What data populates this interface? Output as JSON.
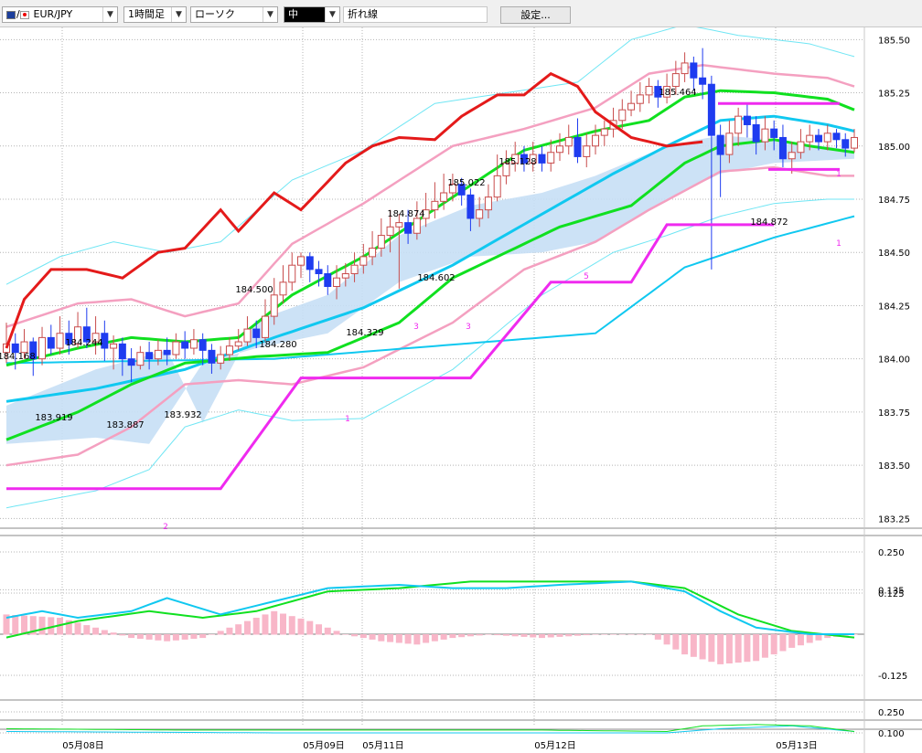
{
  "toolbar": {
    "symbol": "EUR/JPY",
    "timeframe": "1時間足",
    "chart_style": "ローソク",
    "line_width": "中",
    "line_type": "折れ線",
    "settings_button": "設定..."
  },
  "colors": {
    "candle_up": "#c84b4b",
    "candle_down": "#1f3cf0",
    "ma_short": "#10e020",
    "ma_long": "#10c8f0",
    "bollinger_inner": "#f4a0c0",
    "bollinger_outer": "#70e6f4",
    "cloud": "#c6dff5",
    "chikou": "#e41a1a",
    "zigzag": "#ef2aef",
    "macd_hist": "#f8b6c8"
  },
  "chart_data": [
    {
      "type": "candlestick",
      "name": "price",
      "x_labels": [
        "05月08日",
        "05月09日",
        "05月11日",
        "05月12日",
        "05月13日"
      ],
      "y_ticks": [
        183.25,
        183.5,
        183.75,
        184.0,
        184.25,
        184.5,
        184.75,
        185.0,
        185.25,
        185.5
      ],
      "ylim": [
        183.2,
        185.54
      ],
      "grid": true,
      "annotations": [
        "184.168",
        "184.244",
        "183.919",
        "183.887",
        "183.932",
        "184.500",
        "184.280",
        "184.329",
        "184.874",
        "184.602",
        "185.022",
        "185.128",
        "185.464",
        "184.872"
      ],
      "zigzag_labels": [
        "2",
        "1",
        "3",
        "3",
        "5",
        "1",
        "1"
      ],
      "candles": [
        [
          184.03,
          184.07,
          184.17,
          183.98
        ],
        [
          184.07,
          184.03,
          184.12,
          183.95
        ],
        [
          184.03,
          184.08,
          184.14,
          184.0
        ],
        [
          184.08,
          184.0,
          184.1,
          183.92
        ],
        [
          184.0,
          184.1,
          184.15,
          183.97
        ],
        [
          184.1,
          184.05,
          184.16,
          184.02
        ],
        [
          184.05,
          184.12,
          184.2,
          184.02
        ],
        [
          184.12,
          184.07,
          184.18,
          184.02
        ],
        [
          184.07,
          184.15,
          184.22,
          184.05
        ],
        [
          184.15,
          184.08,
          184.24,
          184.05
        ],
        [
          184.08,
          184.12,
          184.2,
          184.02
        ],
        [
          184.12,
          184.05,
          184.18,
          183.99
        ],
        [
          184.05,
          184.07,
          184.11,
          183.95
        ],
        [
          184.07,
          184.0,
          184.1,
          183.92
        ],
        [
          184.0,
          183.97,
          184.05,
          183.89
        ],
        [
          183.97,
          184.03,
          184.06,
          183.95
        ],
        [
          184.03,
          184.0,
          184.08,
          183.95
        ],
        [
          184.0,
          184.04,
          184.09,
          183.97
        ],
        [
          184.04,
          184.02,
          184.1,
          183.97
        ],
        [
          184.02,
          184.08,
          184.12,
          184.0
        ],
        [
          184.08,
          184.05,
          184.13,
          184.0
        ],
        [
          184.05,
          184.09,
          184.14,
          184.02
        ],
        [
          184.09,
          184.04,
          184.12,
          183.97
        ],
        [
          184.04,
          183.98,
          184.07,
          183.93
        ],
        [
          183.98,
          184.02,
          184.06,
          183.95
        ],
        [
          184.02,
          184.06,
          184.1,
          183.99
        ],
        [
          184.06,
          184.08,
          184.14,
          184.04
        ],
        [
          184.08,
          184.14,
          184.2,
          184.06
        ],
        [
          184.14,
          184.1,
          184.18,
          184.05
        ],
        [
          184.1,
          184.2,
          184.28,
          184.08
        ],
        [
          184.2,
          184.3,
          184.38,
          184.16
        ],
        [
          184.3,
          184.36,
          184.44,
          184.26
        ],
        [
          184.36,
          184.44,
          184.5,
          184.32
        ],
        [
          184.44,
          184.48,
          184.5,
          184.38
        ],
        [
          184.48,
          184.42,
          184.5,
          184.36
        ],
        [
          184.42,
          184.4,
          184.46,
          184.34
        ],
        [
          184.4,
          184.34,
          184.44,
          184.3
        ],
        [
          184.34,
          184.38,
          184.44,
          184.28
        ],
        [
          184.38,
          184.4,
          184.45,
          184.34
        ],
        [
          184.4,
          184.44,
          184.5,
          184.36
        ],
        [
          184.44,
          184.48,
          184.54,
          184.4
        ],
        [
          184.48,
          184.52,
          184.6,
          184.44
        ],
        [
          184.52,
          184.58,
          184.66,
          184.48
        ],
        [
          184.58,
          184.62,
          184.7,
          184.5
        ],
        [
          184.62,
          184.64,
          184.68,
          184.33
        ],
        [
          184.64,
          184.59,
          184.7,
          184.54
        ],
        [
          184.59,
          184.66,
          184.74,
          184.56
        ],
        [
          184.66,
          184.7,
          184.78,
          184.62
        ],
        [
          184.7,
          184.74,
          184.83,
          184.66
        ],
        [
          184.74,
          184.78,
          184.87,
          184.7
        ],
        [
          184.78,
          184.82,
          184.87,
          184.74
        ],
        [
          184.82,
          184.77,
          184.85,
          184.72
        ],
        [
          184.77,
          184.66,
          184.8,
          184.6
        ],
        [
          184.66,
          184.7,
          184.76,
          184.62
        ],
        [
          184.7,
          184.76,
          184.82,
          184.66
        ],
        [
          184.76,
          184.86,
          184.96,
          184.74
        ],
        [
          184.86,
          184.92,
          184.98,
          184.82
        ],
        [
          184.92,
          184.96,
          185.02,
          184.88
        ],
        [
          184.96,
          184.92,
          185.0,
          184.88
        ],
        [
          184.92,
          184.96,
          185.02,
          184.88
        ],
        [
          184.96,
          184.92,
          185.0,
          184.88
        ],
        [
          184.92,
          184.97,
          185.03,
          184.88
        ],
        [
          184.97,
          185.0,
          185.06,
          184.93
        ],
        [
          185.0,
          185.04,
          185.1,
          184.96
        ],
        [
          185.04,
          184.95,
          185.13,
          184.92
        ],
        [
          184.95,
          185.0,
          185.06,
          184.9
        ],
        [
          185.0,
          185.05,
          185.1,
          184.96
        ],
        [
          185.05,
          185.08,
          185.12,
          185.0
        ],
        [
          185.08,
          185.12,
          185.18,
          185.04
        ],
        [
          185.12,
          185.17,
          185.22,
          185.08
        ],
        [
          185.17,
          185.2,
          185.26,
          185.14
        ],
        [
          185.2,
          185.24,
          185.3,
          185.16
        ],
        [
          185.24,
          185.28,
          185.32,
          185.2
        ],
        [
          185.28,
          185.23,
          185.31,
          185.18
        ],
        [
          185.23,
          185.28,
          185.34,
          185.2
        ],
        [
          185.28,
          185.34,
          185.4,
          185.24
        ],
        [
          185.34,
          185.39,
          185.44,
          185.3
        ],
        [
          185.39,
          185.32,
          185.42,
          185.26
        ],
        [
          185.32,
          185.29,
          185.46,
          185.22
        ],
        [
          185.29,
          185.05,
          185.33,
          184.42
        ],
        [
          185.05,
          184.96,
          185.1,
          184.76
        ],
        [
          184.96,
          185.06,
          185.12,
          184.92
        ],
        [
          185.06,
          185.14,
          185.18,
          185.0
        ],
        [
          185.14,
          185.1,
          185.2,
          185.04
        ],
        [
          185.1,
          185.02,
          185.14,
          184.96
        ],
        [
          185.02,
          185.08,
          185.14,
          184.98
        ],
        [
          185.08,
          185.04,
          185.12,
          184.98
        ],
        [
          185.04,
          184.94,
          185.1,
          184.9
        ],
        [
          184.94,
          184.97,
          185.02,
          184.87
        ],
        [
          184.97,
          185.02,
          185.08,
          184.94
        ],
        [
          185.02,
          185.05,
          185.1,
          184.98
        ],
        [
          185.05,
          185.02,
          185.08,
          184.98
        ],
        [
          185.02,
          185.06,
          185.1,
          184.98
        ],
        [
          185.06,
          185.03,
          185.08,
          184.99
        ],
        [
          185.03,
          184.99,
          185.06,
          184.95
        ],
        [
          184.99,
          185.04,
          185.08,
          184.97
        ]
      ]
    },
    {
      "type": "line",
      "name": "macd",
      "y_ticks": [
        0.25,
        0.135,
        0.125,
        -0.125
      ],
      "y_labels": [
        "0.250",
        "0.135",
        "0.125",
        "-0.125"
      ],
      "ylim": [
        -0.2,
        0.3
      ],
      "grid": true
    },
    {
      "type": "line",
      "name": "oscillator",
      "y_ticks": [
        0.25,
        0.1
      ],
      "y_labels": [
        "0.250",
        "0.100"
      ],
      "grid": true
    }
  ]
}
